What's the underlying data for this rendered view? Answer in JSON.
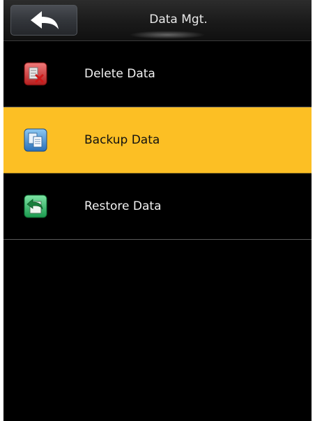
{
  "header": {
    "title": "Data Mgt.",
    "back_icon": "back-arrow-icon"
  },
  "menu": {
    "selected_index": 1,
    "items": [
      {
        "label": "Delete Data",
        "icon": "delete-data-icon"
      },
      {
        "label": "Backup Data",
        "icon": "backup-data-icon"
      },
      {
        "label": "Restore Data",
        "icon": "restore-data-icon"
      }
    ]
  },
  "colors": {
    "background": "#000000",
    "selected_row": "#fcbf24",
    "text": "#f2f2f2"
  }
}
